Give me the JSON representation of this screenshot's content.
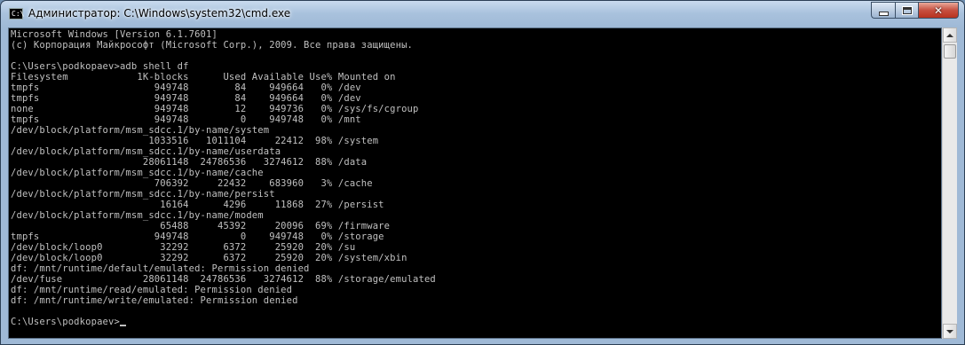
{
  "window": {
    "title": "Администратор: C:\\Windows\\system32\\cmd.exe",
    "icon_label": "C:\\",
    "controls": {
      "minimize": "minimize",
      "maximize": "maximize",
      "close": "✕"
    }
  },
  "console": {
    "lines": [
      "Microsoft Windows [Version 6.1.7601]",
      "(c) Корпорация Майкрософт (Microsoft Corp.), 2009. Все права защищены.",
      "",
      "C:\\Users\\podkopaev>adb shell df",
      "Filesystem            1K-blocks      Used Available Use% Mounted on",
      "tmpfs                    949748        84    949664   0% /dev",
      "tmpfs                    949748        84    949664   0% /dev",
      "none                     949748        12    949736   0% /sys/fs/cgroup",
      "tmpfs                    949748         0    949748   0% /mnt",
      "/dev/block/platform/msm_sdcc.1/by-name/system",
      "                        1033516   1011104     22412  98% /system",
      "/dev/block/platform/msm_sdcc.1/by-name/userdata",
      "                       28061148  24786536   3274612  88% /data",
      "/dev/block/platform/msm_sdcc.1/by-name/cache",
      "                         706392     22432    683960   3% /cache",
      "/dev/block/platform/msm_sdcc.1/by-name/persist",
      "                          16164      4296     11868  27% /persist",
      "/dev/block/platform/msm_sdcc.1/by-name/modem",
      "                          65488     45392     20096  69% /firmware",
      "tmpfs                    949748         0    949748   0% /storage",
      "/dev/block/loop0          32292      6372     25920  20% /su",
      "/dev/block/loop0          32292      6372     25920  20% /system/xbin",
      "df: /mnt/runtime/default/emulated: Permission denied",
      "/dev/fuse              28061148  24786536   3274612  88% /storage/emulated",
      "df: /mnt/runtime/read/emulated: Permission denied",
      "df: /mnt/runtime/write/emulated: Permission denied",
      "",
      "C:\\Users\\podkopaev>"
    ],
    "text_color": "#c0c0c0",
    "background": "#000000"
  }
}
